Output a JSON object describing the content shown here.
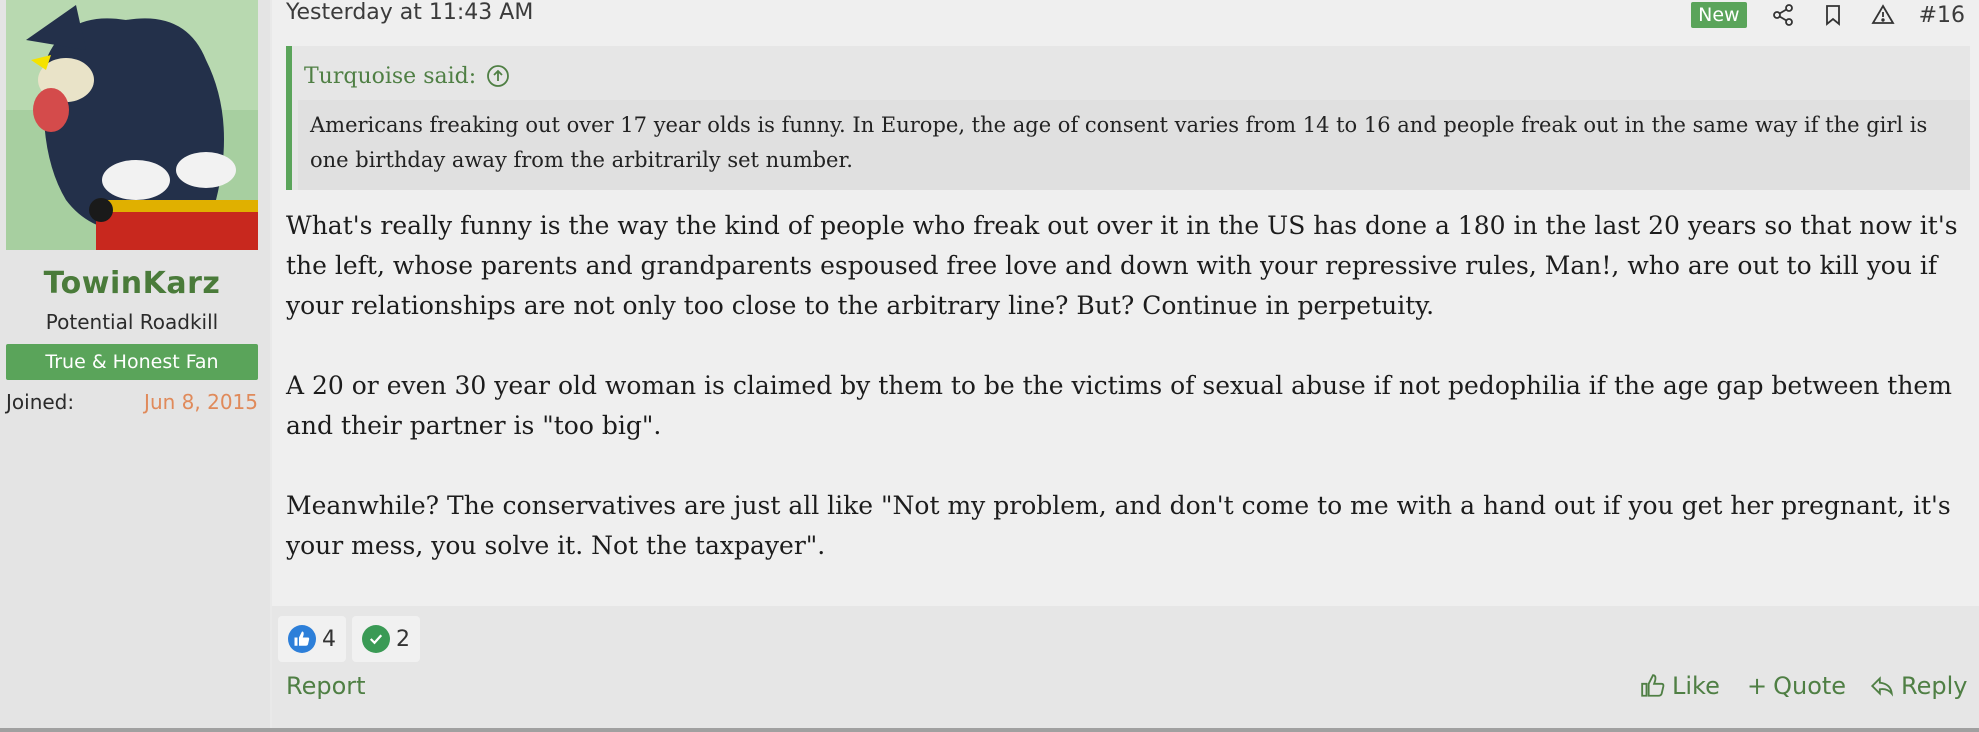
{
  "user": {
    "name": "TowinKarz",
    "title": "Potential Roadkill",
    "banner": "True & Honest Fan",
    "joined_label": "Joined:",
    "joined_value": "Jun 8, 2015"
  },
  "post": {
    "date": "Yesterday at 11:43 AM",
    "new_badge": "New",
    "number": "#16",
    "quote": {
      "author": "Turquoise said:",
      "text": "Americans freaking out over 17 year olds is funny. In Europe, the age of consent varies from 14 to 16 and people freak out in the same way if the girl is one birthday away from the arbitrarily set number."
    },
    "paragraphs": [
      "What's really funny is the way the kind of people who freak out over it in the US has done a 180 in the last 20 years so that now it's the left, whose parents and grandparents espoused free love and down with your repressive rules, Man!, who are out to kill you if your relationships are not only too close to the arbitrary line? But? Continue in perpetuity.",
      "A 20 or even 30 year old woman is claimed by them to be the victims of sexual abuse if not pedophilia if the age gap between them and their partner is \"too big\".",
      "Meanwhile? The conservatives are just all like \"Not my problem, and don't come to me with a hand out if you get her pregnant, it's your mess, you solve it. Not the taxpayer\"."
    ]
  },
  "reactions": {
    "like_count": "4",
    "agree_count": "2"
  },
  "footer": {
    "report": "Report",
    "like": "Like",
    "quote": "Quote",
    "reply": "Reply"
  },
  "colors": {
    "accent": "#5aa45a",
    "link": "#4f7f44",
    "joined_date": "#e08a5a"
  }
}
